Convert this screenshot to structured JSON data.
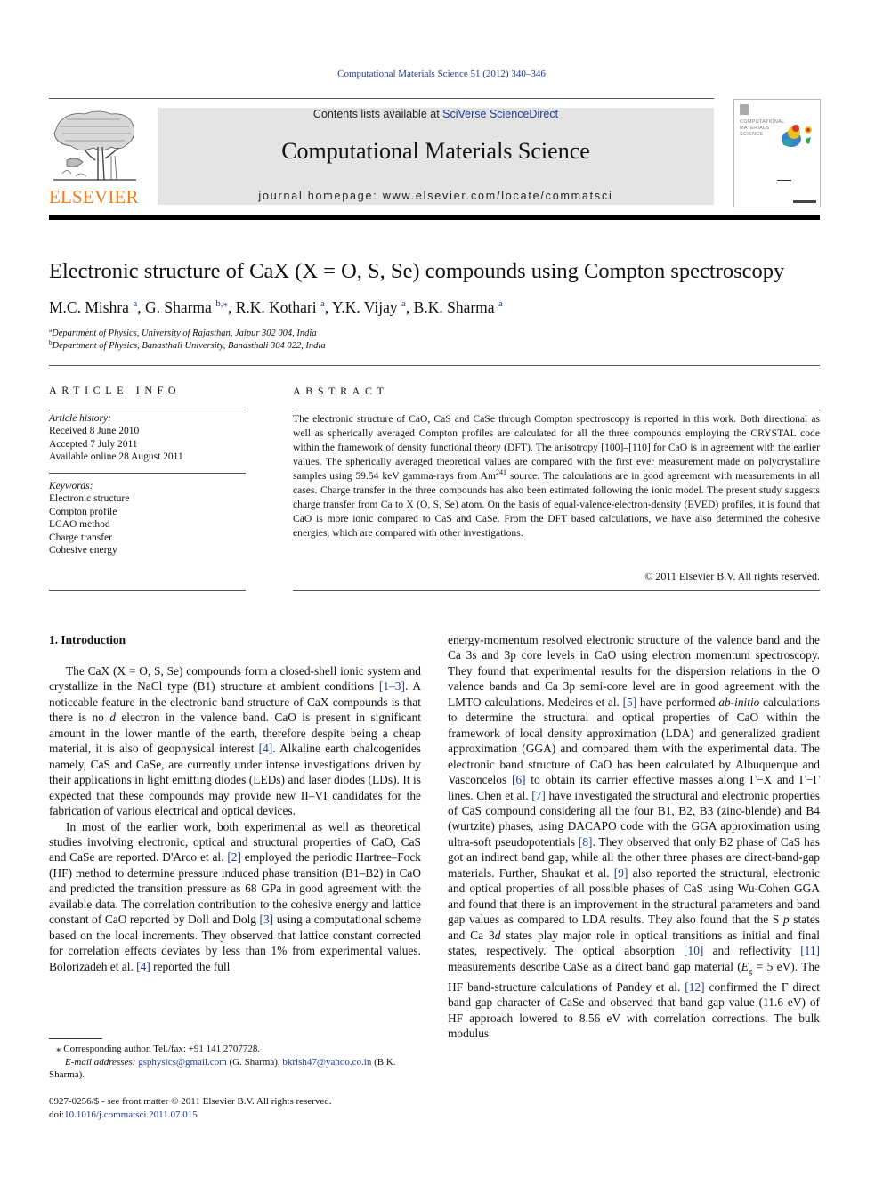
{
  "running_head": "Computational Materials Science 51 (2012) 340–346",
  "masthead": {
    "publisher_logo_text": "ELSEVIER",
    "contents_prefix": "Contents lists available at ",
    "contents_link": "SciVerse ScienceDirect",
    "journal_title": "Computational Materials Science",
    "homepage": "journal homepage: www.elsevier.com/locate/commatsci",
    "cover_title_lines": [
      "COMPUTATIONAL",
      "MATERIALS",
      "SCIENCE"
    ]
  },
  "article": {
    "title": "Electronic structure of CaX (X = O, S, Se) compounds using Compton spectroscopy",
    "authors": [
      {
        "name": "M.C. Mishra",
        "sup": "a"
      },
      {
        "name": "G. Sharma",
        "sup": "b,⁎"
      },
      {
        "name": "R.K. Kothari",
        "sup": "a"
      },
      {
        "name": "Y.K. Vijay",
        "sup": "a"
      },
      {
        "name": "B.K. Sharma",
        "sup": "a"
      }
    ],
    "affiliations": [
      {
        "sup": "a",
        "text": "Department of Physics, University of Rajasthan, Jaipur 302 004, India"
      },
      {
        "sup": "b",
        "text": "Department of Physics, Banasthali University, Banasthali 304 022, India"
      }
    ]
  },
  "article_info": {
    "heading": "ARTICLE INFO",
    "history_label": "Article history:",
    "history": [
      "Received 8 June 2010",
      "Accepted 7 July 2011",
      "Available online 28 August 2011"
    ],
    "keywords_label": "Keywords:",
    "keywords": [
      "Electronic structure",
      "Compton profile",
      "LCAO method",
      "Charge transfer",
      "Cohesive energy"
    ]
  },
  "abstract": {
    "heading": "ABSTRACT",
    "text_part1": "The electronic structure of CaO, CaS and CaSe through Compton spectroscopy is reported in this work. Both directional as well as spherically averaged Compton profiles are calculated for all the three compounds employing the CRYSTAL code within the framework of density functional theory (DFT). The anisotropy [100]–[110] for CaO is in agreement with the earlier values. The spherically averaged theoretical values are compared with the first ever measurement made on polycrystalline samples using 59.54 keV gamma-rays from Am",
    "sup": "241",
    "text_part2": " source. The calculations are in good agreement with measurements in all cases. Charge transfer in the three compounds has also been estimated following the ionic model. The present study suggests charge transfer from Ca to X (O, S, Se) atom. On the basis of equal-valence-electron-density (EVED) profiles, it is found that CaO is more ionic compared to CaS and CaSe. From the DFT based calculations, we have also determined the cohesive energies, which are compared with other investigations.",
    "copyright": "© 2011 Elsevier B.V. All rights reserved."
  },
  "body": {
    "section_heading": "1. Introduction",
    "left_col": {
      "p1": [
        "The CaX (X = O, S, Se) compounds form a closed-shell ionic system and crystallize in the NaCl type (B1) structure at ambient conditions ",
        "[1–3]",
        ". A noticeable feature in the electronic band structure of CaX compounds is that there is no ",
        "d",
        " electron in the valence band. CaO is present in significant amount in the lower mantle of the earth, therefore despite being a cheap material, it is also of geophysical interest ",
        "[4]",
        ". Alkaline earth chalcogenides namely, CaS and CaSe, are currently under intense investigations driven by their applications in light emitting diodes (LEDs) and laser diodes (LDs). It is expected that these compounds may provide new II–VI candidates for the fabrication of various electrical and optical devices."
      ],
      "p2": [
        "In most of the earlier work, both experimental as well as theoretical studies involving electronic, optical and structural properties of CaO, CaS and CaSe are reported. D'Arco et al. ",
        "[2]",
        " employed the periodic Hartree–Fock (HF) method to determine pressure induced phase transition (B1–B2) in CaO and predicted the transition pressure as 68 GPa in good agreement with the available data. The correlation contribution to the cohesive energy and lattice constant of CaO reported by Doll and Dolg ",
        "[3]",
        " using a computational scheme based on the local increments. They observed that lattice constant corrected for correlation effects deviates by less than 1% from experimental values. Bolorizadeh et al. ",
        "[4]",
        " reported the full"
      ]
    },
    "right_col": [
      "energy-momentum resolved electronic structure of the valence band and the Ca 3s and 3p core levels in CaO using electron momentum spectroscopy. They found that experimental results for the dispersion relations in the O valence bands and Ca 3p semi-core level are in good agreement with the LMTO calculations. Medeiros et al. ",
      "[5]",
      " have performed ",
      "ab-initio",
      " calculations to determine the structural and optical properties of CaO within the framework of local density approximation (LDA) and generalized gradient approximation (GGA) and compared them with the experimental data. The electronic band structure of CaO has been calculated by Albuquerque and Vasconcelos ",
      "[6]",
      " to obtain its carrier effective masses along Γ−X and Γ−Γ lines. Chen et al. ",
      "[7]",
      " have investigated the structural and electronic properties of CaS compound considering all the four B1, B2, B3 (zinc-blende) and B4 (wurtzite) phases, using DACAPO code with the GGA approximation using ultra-soft pseudopotentials ",
      "[8]",
      ". They observed that only B2 phase of CaS has got an indirect band gap, while all the other three phases are direct-band-gap materials. Further, Shaukat et al. ",
      "[9]",
      " also reported the structural, electronic and optical properties of all possible phases of CaS using Wu-Cohen GGA and found that there is an improvement in the structural parameters and band gap values as compared to LDA results. They also found that the S ",
      "p",
      " states and Ca 3",
      "d",
      " states play major role in optical transitions as initial and final states, respectively. The optical absorption ",
      "[10]",
      " and reflectivity ",
      "[11]",
      " measurements describe CaSe as a direct band gap material (",
      "E",
      "g",
      " = 5 eV). The HF band-structure calculations of Pandey et al. ",
      "[12]",
      " confirmed the Γ direct band gap character of CaSe and observed that band gap value (11.6 eV) of HF approach lowered to 8.56 eV with correlation corrections. The bulk modulus"
    ]
  },
  "footnotes": {
    "corresponding": "⁎  Corresponding author. Tel./fax: +91 141 2707728.",
    "email_label": "E-mail addresses: ",
    "email1": "gsphysics@gmail.com",
    "email1_owner": " (G. Sharma), ",
    "email2": "bkrish47@yahoo.co.in",
    "email2_owner": " (B.K. Sharma).",
    "issn": "0927-0256/$ - see front matter © 2011 Elsevier B.V. All rights reserved.",
    "doi_label": "doi:",
    "doi": "10.1016/j.commatsci.2011.07.015"
  }
}
